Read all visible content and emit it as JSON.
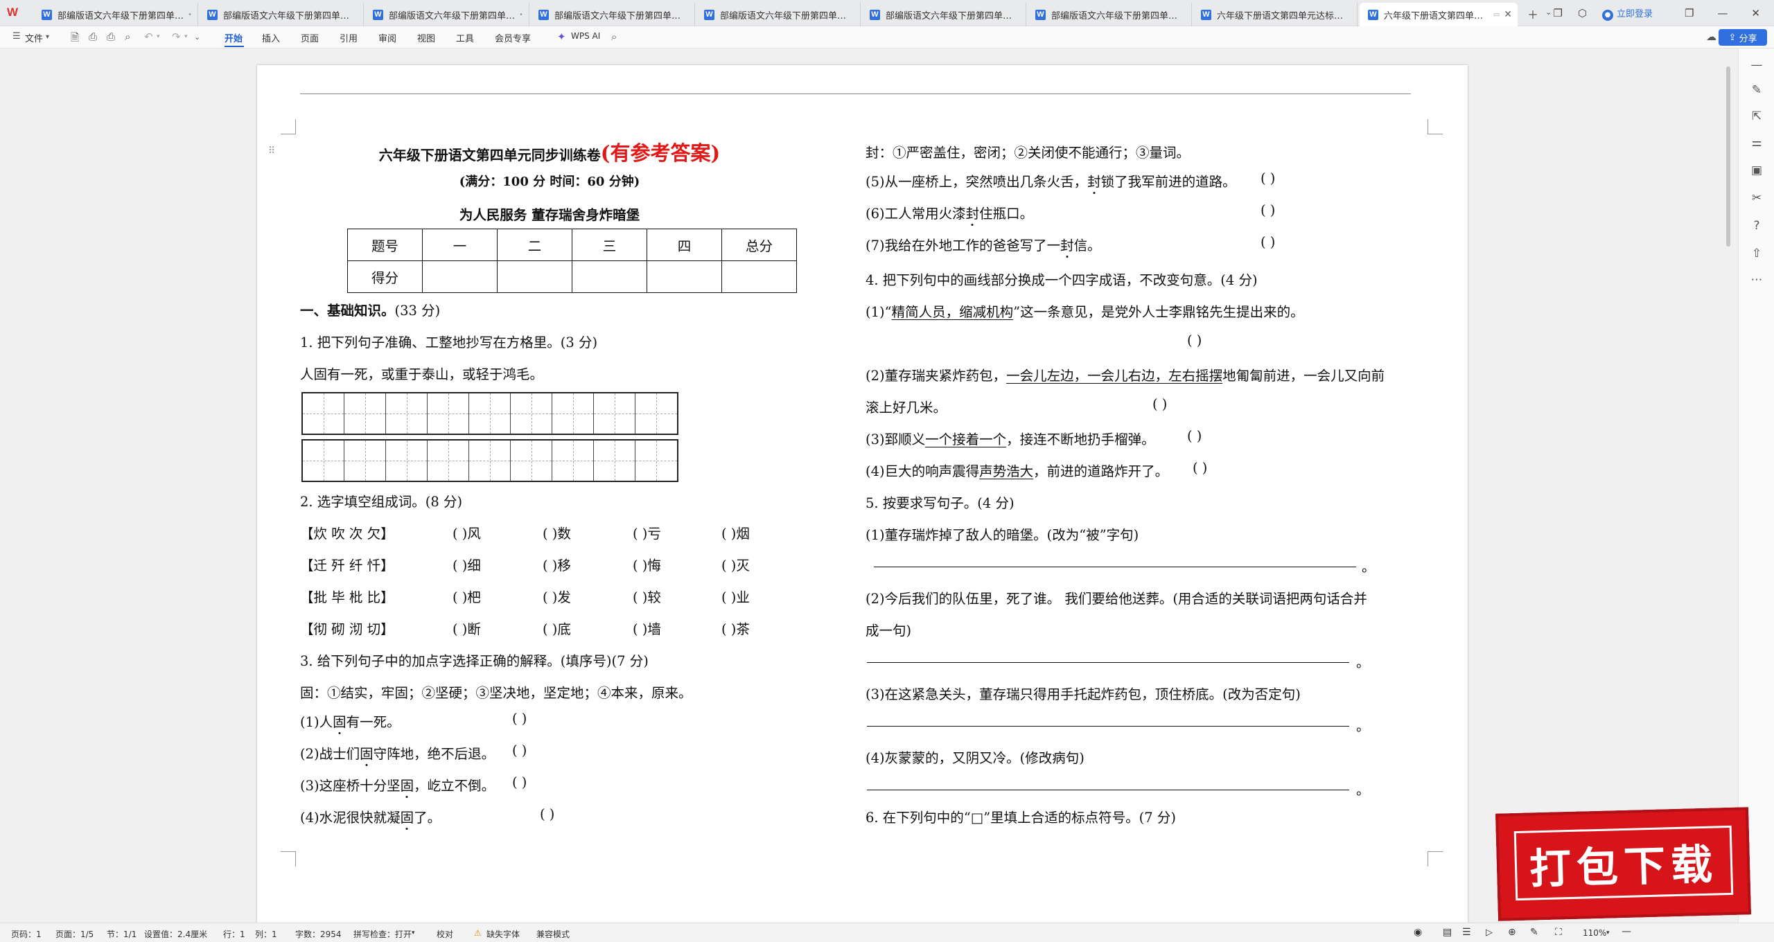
{
  "app": {
    "logo": "W"
  },
  "tabs": [
    {
      "label": "部编版语文六年级下册第四单元 综合"
    },
    {
      "label": "部编版语文六年级下册第四单元测试"
    },
    {
      "label": "部编版语文六年级下册第四单元检"
    },
    {
      "label": "部编版语文六年级下册第四单元考点"
    },
    {
      "label": "部编版语文六年级下册第四单元同步"
    },
    {
      "label": "部编版语文六年级下册第四单元综合"
    },
    {
      "label": "部编版语文六年级下册第四单元综合"
    },
    {
      "label": "六年级下册语文第四单元达标测试卷"
    },
    {
      "label": "六年级下册语文第四单元同步"
    }
  ],
  "topright": {
    "login": "立即登录"
  },
  "toolbar": {
    "file": "文件",
    "menus": [
      "开始",
      "插入",
      "页面",
      "引用",
      "审阅",
      "视图",
      "工具",
      "会员专享"
    ],
    "wps_ai": "WPS AI",
    "share": "分享"
  },
  "doc": {
    "title": "六年级下册语文第四单元同步训练卷",
    "title_red": "(有参考答案)",
    "subtitle": "(满分：100 分    时间：60 分钟)",
    "topics": "为人民服务      董存瑞舍身炸暗堡",
    "score_table": {
      "row1": [
        "题号",
        "一",
        "二",
        "三",
        "四",
        "总分"
      ],
      "row2": [
        "得分",
        "",
        "",
        "",
        "",
        ""
      ]
    },
    "left": {
      "sec1": "一、基础知识。",
      "sec1_score": "(33 分)",
      "q1": "1. 把下列句子准确、工整地抄写在方格里。(3 分)",
      "q1_sentence": "人固有一死，或重于泰山，或轻于鸿毛。",
      "q2": "2. 选字填空组成词。(8 分)",
      "q2_rows": [
        {
          "chars": "【炊  吹  次  欠】",
          "blanks": [
            "(      )风",
            "(      )数",
            "(      )亏",
            "(      )烟"
          ]
        },
        {
          "chars": "【迁  歼  纤  忏】",
          "blanks": [
            "(      )细",
            "(      )移",
            "(      )悔",
            "(      )灭"
          ]
        },
        {
          "chars": "【批  毕  枇  比】",
          "blanks": [
            "(      )杷",
            "(      )发",
            "(      )较",
            "(      )业"
          ]
        },
        {
          "chars": "【彻  砌  沏  切】",
          "blanks": [
            "(      )断",
            "(      )底",
            "(      )墙",
            "(      )茶"
          ]
        }
      ],
      "q3": "3. 给下列句子中的加点字选择正确的解释。(填序号)(7 分)",
      "q3_gu": "固：①结实，牢固；②坚硬；③坚决地，坚定地；④本来，原来。",
      "q3_items": [
        {
          "pre": "(1)人",
          "dot": "固",
          "post": "有一死。",
          "paren": "(      )"
        },
        {
          "pre": "(2)战士们",
          "dot": "固",
          "post": "守阵地，绝不后退。",
          "paren": "(      )"
        },
        {
          "pre": "(3)这座桥十分坚",
          "dot": "固",
          "post": "，屹立不倒。",
          "paren": "(      )"
        },
        {
          "pre": "(4)水泥很快就凝",
          "dot": "固",
          "post": "了。",
          "paren": "(      )"
        }
      ]
    },
    "right": {
      "feng": "封：①严密盖住，密闭；②关闭使不能通行；③量词。",
      "feng_items": [
        {
          "pre": "(5)从一座桥上，突然喷出几条火舌，",
          "dot": "封",
          "post": "锁了我军前进的道路。",
          "paren": "(      )"
        },
        {
          "pre": "(6)工人常用火漆",
          "dot": "封",
          "post": "住瓶口。",
          "paren": "(      )"
        },
        {
          "pre": "(7)我给在外地工作的爸爸写了一",
          "dot": "封",
          "post": "信。",
          "paren": "(      )"
        }
      ],
      "q4": "4. 把下列句中的画线部分换成一个四字成语，不改变句意。(4 分)",
      "q4_1_pre": "(1)“",
      "q4_1_ul": "精简人员，缩减机构",
      "q4_1_post": "”这一条意见，是党外人士李鼎铭先生提出来的。",
      "q4_1_paren": "(                  )",
      "q4_2_pre": "(2)董存瑞夹紧炸药包，",
      "q4_2_ul": "一会儿左边，一会儿右边，左右摇摆",
      "q4_2_post": "地匍匐前进，一会儿又向前",
      "q4_2_line2": "滚上好几米。",
      "q4_2_paren": "(                  )",
      "q4_3_pre": "(3)郅顺义",
      "q4_3_ul": "一个接着一个",
      "q4_3_post": "，接连不断地扔手榴弹。",
      "q4_3_paren": "(                  )",
      "q4_4_pre": "(4)巨大的响声震得",
      "q4_4_ul": "声势浩大",
      "q4_4_post": "，前进的道路炸开了。",
      "q4_4_paren": "(                  )",
      "q5": "5. 按要求写句子。(4 分)",
      "q5_1": "(1)董存瑞炸掉了敌人的暗堡。(改为“被”字句)",
      "q5_2": "(2)今后我们的队伍里，死了谁。  我们要给他送葬。(用合适的关联词语把两句话合并",
      "q5_2_cont": "成一句)",
      "q5_3": "(3)在这紧急关头，董存瑞只得用手托起炸药包，顶住桥底。(改为否定句)",
      "q5_4": "(4)灰蒙蒙的，又阴又冷。(修改病句)",
      "period": "。",
      "q6": "6. 在下列句中的“□”里填上合适的标点符号。(7 分)"
    }
  },
  "status": {
    "page": "页码：1",
    "pages": "页面：1/5",
    "section": "节：1/1",
    "setting": "设置值：2.4厘米",
    "row": "行：1",
    "col": "列：1",
    "words": "字数：2954",
    "spell": "拼写检查：打开",
    "proof": "校对",
    "missing_font": "缺失字体",
    "compat": "兼容模式",
    "zoom": "110%"
  },
  "banner": {
    "text": "打包下载"
  }
}
